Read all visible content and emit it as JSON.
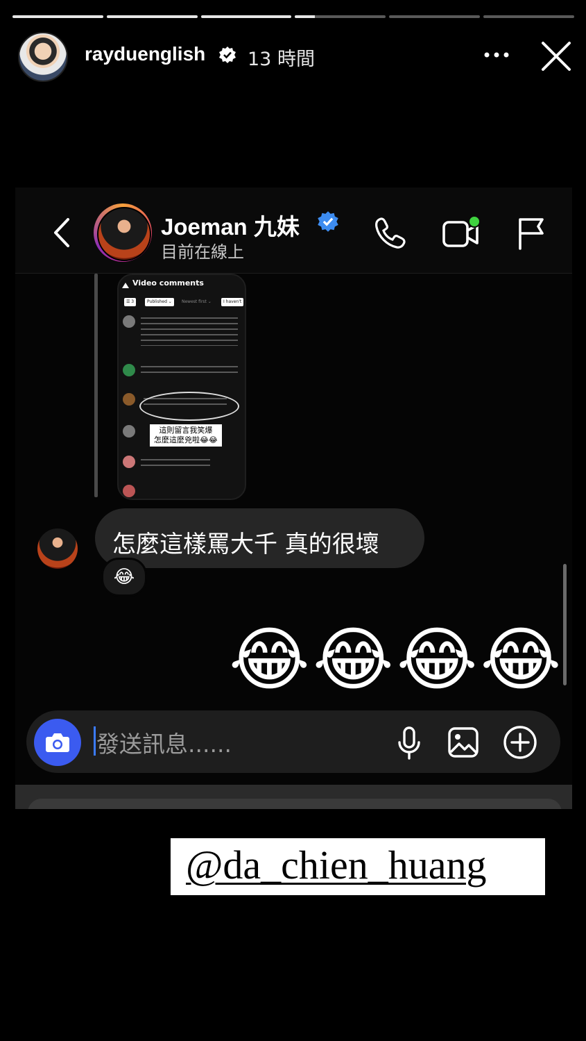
{
  "story": {
    "segments": [
      1,
      1,
      1,
      0.22,
      0,
      0
    ],
    "username": "rayduenglish",
    "time": "13 時間"
  },
  "chat": {
    "contact_name": "Joeman 九妹",
    "status": "目前在線上",
    "embedded": {
      "title": "Video comments",
      "filters": [
        "☰ 3",
        "Published ⌄",
        "Newest first ⌄",
        "I haven't"
      ],
      "caption_line1": "這則留言我笑爆",
      "caption_line2": "怎麼這麼兇啦😂😂"
    },
    "message": "怎麼這樣罵大千 真的很壞",
    "reaction": "😂",
    "emoji_reply": "😂😂😂😂",
    "composer_placeholder": "發送訊息......"
  },
  "mention": "@da_chien_huang",
  "colors": {
    "background": "#000000",
    "bubble": "#262626",
    "camera_button": "#3b5bf0",
    "verified": "#3d8cf0",
    "online_dot": "#3fd23f"
  }
}
